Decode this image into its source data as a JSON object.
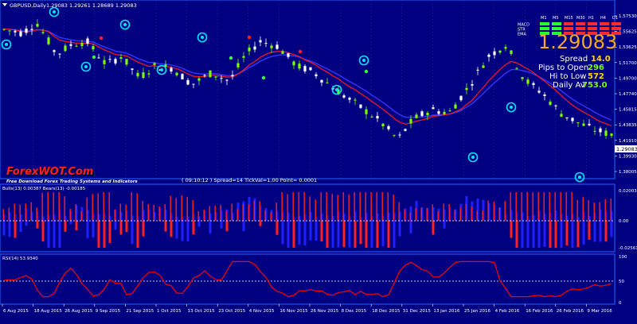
{
  "colors": {
    "background": "#000080",
    "grid": "#3a4fa6",
    "axis_line": "#1e6cff",
    "axis_text": "#ffffff",
    "bull_candle": "#7cfc00",
    "bear_candle": "#ffffff",
    "ema_red": "#ff1a1a",
    "ema_blue": "#3535ff",
    "marker_ring": "#00e5ff",
    "bulls_bar": "#2020ff",
    "bears_bar": "#ff2020",
    "rsi_line": "#ff0000",
    "price_big": "#f5a623",
    "spread_value": "#ffd700",
    "pips_value": "#7cfc00",
    "hilo_value": "#ffd700",
    "daily_value": "#7cfc00",
    "signal_green": "#2aff2a",
    "signal_red": "#ff2a2a"
  },
  "main": {
    "symbol_label": "GBPUSD,Daily",
    "ohlc": "1.29083 1.29261 1.28689 1.29083",
    "logo_title": "ForexWOT.Com",
    "logo_subtitle": "Free Download Forex Trading Systems and Indicators",
    "status": "( 09:10:12 )  Spread=14  TickVal=1.00  Point= 0.0001",
    "price_axis": [
      "1.57530",
      "1.55625",
      "1.53625",
      "1.51700",
      "1.49700",
      "1.47740",
      "1.45815",
      "1.43835",
      "1.41910",
      "1.39930",
      "1.38005"
    ],
    "current_price_tag": "1.29083"
  },
  "panel": {
    "timeframes": [
      "M1",
      "M5",
      "M15",
      "M30",
      "H1",
      "H4",
      "D1"
    ],
    "rows": [
      {
        "label": "MACD",
        "signals": [
          "green",
          "green",
          "red",
          "red",
          "red",
          "red",
          "red"
        ]
      },
      {
        "label": "STR",
        "signals": [
          "green",
          "green",
          "red",
          "red",
          "red",
          "red",
          "red"
        ]
      },
      {
        "label": "EMA",
        "signals": [
          "green",
          "green",
          "red",
          "red",
          "red",
          "red",
          "red"
        ]
      }
    ],
    "big_price": "1.29083",
    "spread_label": "Spread",
    "spread_value": "14.0",
    "pips_label": "Pips to Open",
    "pips_value": "296",
    "hilo_label": "Hi to Low",
    "hilo_value": "572",
    "daily_label": "Daily Av",
    "daily_value": "753.0"
  },
  "bulls_bears": {
    "label": "Bulls(13) 0.00387  Bears(13) -0.00185",
    "axis": [
      "0.02003",
      "0.00",
      "-0.02561"
    ]
  },
  "rsi": {
    "label": "RSI(14) 53.9340",
    "axis": [
      "100",
      "50",
      "0"
    ]
  },
  "dates": [
    "6 Aug 2015",
    "18 Aug 2015",
    "26 Aug 2015",
    "9 Sep 2015",
    "21 Sep 2015",
    "1 Oct 2015",
    "13 Oct 2015",
    "23 Oct 2015",
    "4 Nov 2015",
    "16 Nov 2015",
    "26 Nov 2015",
    "8 Dec 2015",
    "18 Dec 2015",
    "31 Dec 2015",
    "13 Jan 2016",
    "25 Jan 2016",
    "4 Feb 2016",
    "16 Feb 2016",
    "26 Feb 2016",
    "9 Mar 2016"
  ]
}
